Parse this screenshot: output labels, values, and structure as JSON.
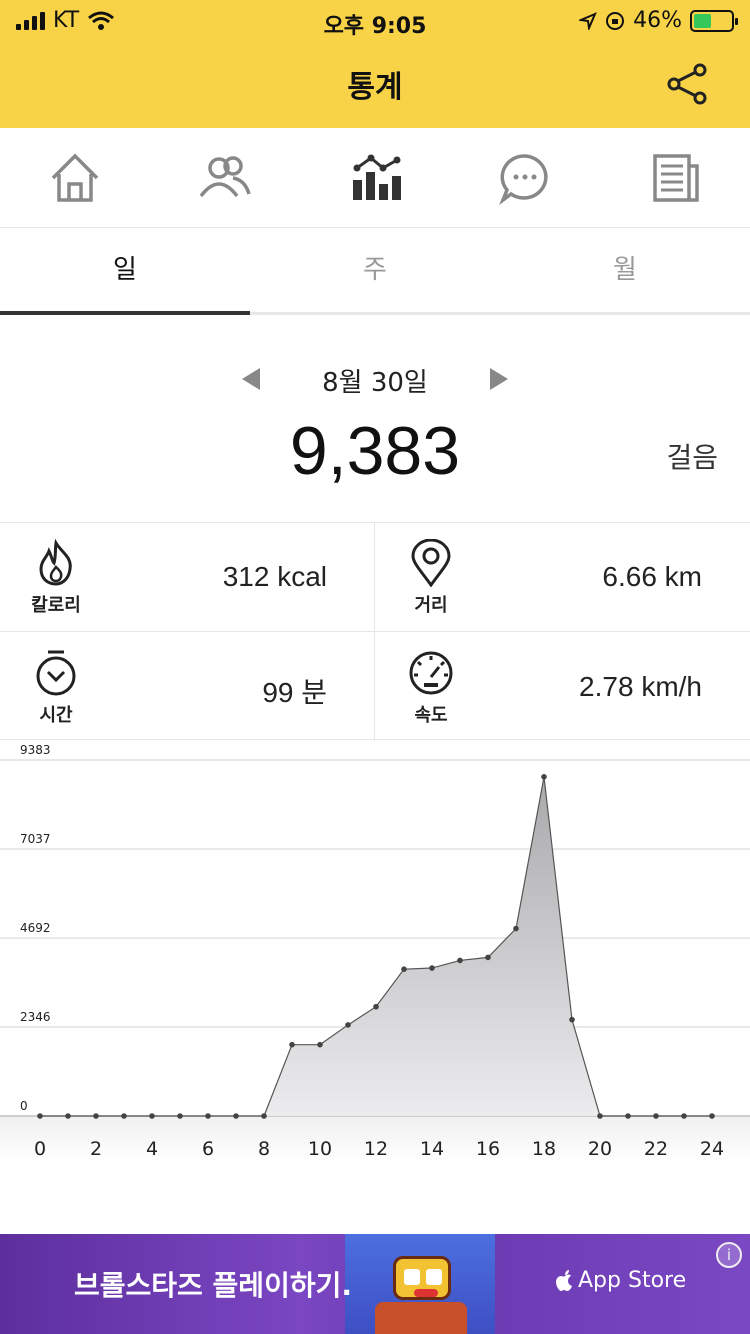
{
  "status_bar": {
    "carrier": "KT",
    "time": "오후 9:05",
    "battery_percent": "46%",
    "battery_level": 0.46
  },
  "header": {
    "title": "통계",
    "share_icon": "share-icon"
  },
  "nav": {
    "items": [
      {
        "icon": "home-icon"
      },
      {
        "icon": "friends-icon"
      },
      {
        "icon": "stats-icon",
        "active": true
      },
      {
        "icon": "chat-icon"
      },
      {
        "icon": "news-icon"
      }
    ]
  },
  "tabs": [
    {
      "label": "일",
      "active": true
    },
    {
      "label": "주"
    },
    {
      "label": "월"
    }
  ],
  "summary": {
    "date": "8월 30일",
    "steps": "9,383",
    "steps_unit": "걸음"
  },
  "stats": {
    "calorie": {
      "label": "칼로리",
      "value": "312 kcal",
      "icon": "fire-icon"
    },
    "distance": {
      "label": "거리",
      "value": "6.66 km",
      "icon": "location-pin-icon"
    },
    "time": {
      "label": "시간",
      "value": "99 분",
      "icon": "timer-icon"
    },
    "speed": {
      "label": "속도",
      "value": "2.78 km/h",
      "icon": "speedometer-icon"
    }
  },
  "chart_data": {
    "type": "area",
    "x": [
      0,
      1,
      2,
      3,
      4,
      5,
      6,
      7,
      8,
      9,
      10,
      11,
      12,
      13,
      14,
      15,
      16,
      17,
      18,
      19,
      20,
      21,
      22,
      23,
      24
    ],
    "values": [
      0,
      0,
      0,
      0,
      0,
      0,
      0,
      0,
      0,
      1880,
      1880,
      2400,
      2880,
      3870,
      3900,
      4100,
      4180,
      4940,
      8940,
      2540,
      0,
      0,
      0,
      0,
      0
    ],
    "x_tick_labels": [
      "0",
      "2",
      "4",
      "6",
      "8",
      "10",
      "12",
      "14",
      "16",
      "18",
      "20",
      "22",
      "24"
    ],
    "y_tick_labels": [
      "0",
      "2346",
      "4692",
      "7037",
      "9383"
    ],
    "xlim": [
      0,
      24
    ],
    "ylim": [
      0,
      9383
    ],
    "grid": true
  },
  "ad": {
    "text": "브롤스타즈 플레이하기.",
    "store": "App Store",
    "info": "i"
  },
  "colors": {
    "header_bg": "#f8d347",
    "ad_bg": "#6a3aa8"
  }
}
